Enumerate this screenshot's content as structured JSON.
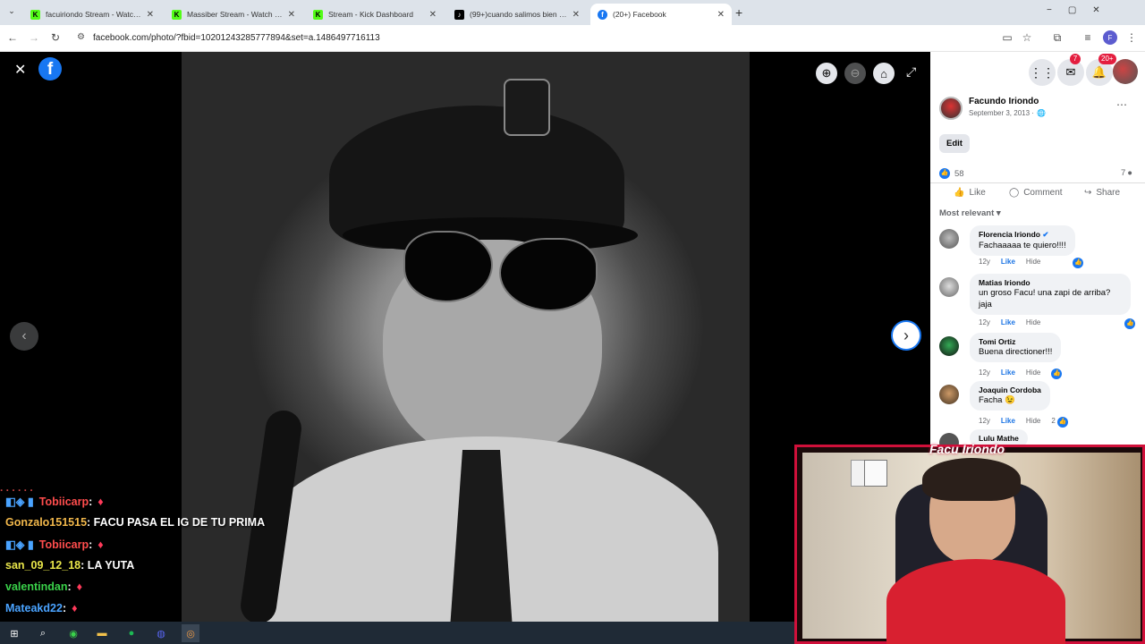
{
  "browser": {
    "tabs": [
      {
        "title": "facuiriondo Stream - Watch Liv",
        "icon": "kick-icon",
        "color": "#53fc18"
      },
      {
        "title": "Massiber Stream - Watch Live o",
        "icon": "kick-icon",
        "color": "#53fc18"
      },
      {
        "title": "Stream - Kick Dashboard",
        "icon": "kick-icon",
        "color": "#53fc18"
      },
      {
        "title": "(99+)cuando salimos bien en u",
        "icon": "tiktok-icon",
        "color": "#000000"
      },
      {
        "title": "(20+) Facebook",
        "icon": "facebook-icon",
        "color": "#1877f2"
      }
    ],
    "url": "facebook.com/photo/?fbid=10201243285777894&set=a.1486497716113"
  },
  "header": {
    "messenger_badge": "7",
    "notifications_badge": "20+"
  },
  "post": {
    "author": "Facundo Iriondo",
    "date": "September 3, 2013 ·",
    "edit_label": "Edit",
    "reactions": "58",
    "comment_count": "7",
    "like_label": "Like",
    "comment_label": "Comment",
    "share_label": "Share",
    "sort_label": "Most relevant"
  },
  "comments": [
    {
      "name": "Florencia Iriondo",
      "text": "Fachaaaaa te quiero!!!!",
      "age": "12y",
      "like": "Like",
      "hide": "Hide",
      "verified": true,
      "reactions": ""
    },
    {
      "name": "Matias Iriondo",
      "text": "un groso Facu! una zapi de arriba? jaja",
      "age": "12y",
      "like": "Like",
      "hide": "Hide",
      "reactions": ""
    },
    {
      "name": "Tomi Ortiz",
      "text": "Buena directioner!!!",
      "age": "12y",
      "like": "Like",
      "hide": "Hide",
      "reactions": ""
    },
    {
      "name": "Joaquin Cordoba",
      "text": "Facha 😉",
      "age": "12y",
      "like": "Like",
      "hide": "Hide",
      "reactions": "2"
    },
    {
      "name": "Lulu Mathe",
      "text": "",
      "age": "",
      "like": "",
      "hide": "",
      "reactions": ""
    }
  ],
  "chat": [
    {
      "user": "Tobiicarp",
      "msg": ":",
      "cls": "u3",
      "badges": true
    },
    {
      "user": "Gonzalo151515",
      "msg": ": FACU PASA EL IG DE TU PRIMA",
      "cls": "u4",
      "badges": false
    },
    {
      "user": "Tobiicarp",
      "msg": ":",
      "cls": "u3",
      "badges": true
    },
    {
      "user": "san_09_12_18",
      "msg": ": LA YUTA",
      "cls": "u1",
      "badges": false
    },
    {
      "user": "valentindan",
      "msg": ":",
      "cls": "u2",
      "badges": false
    },
    {
      "user": "Mateakd22",
      "msg": ":",
      "cls": "u5",
      "badges": false
    }
  ],
  "webcam": {
    "overlay_name": "Facu Iriondo"
  }
}
